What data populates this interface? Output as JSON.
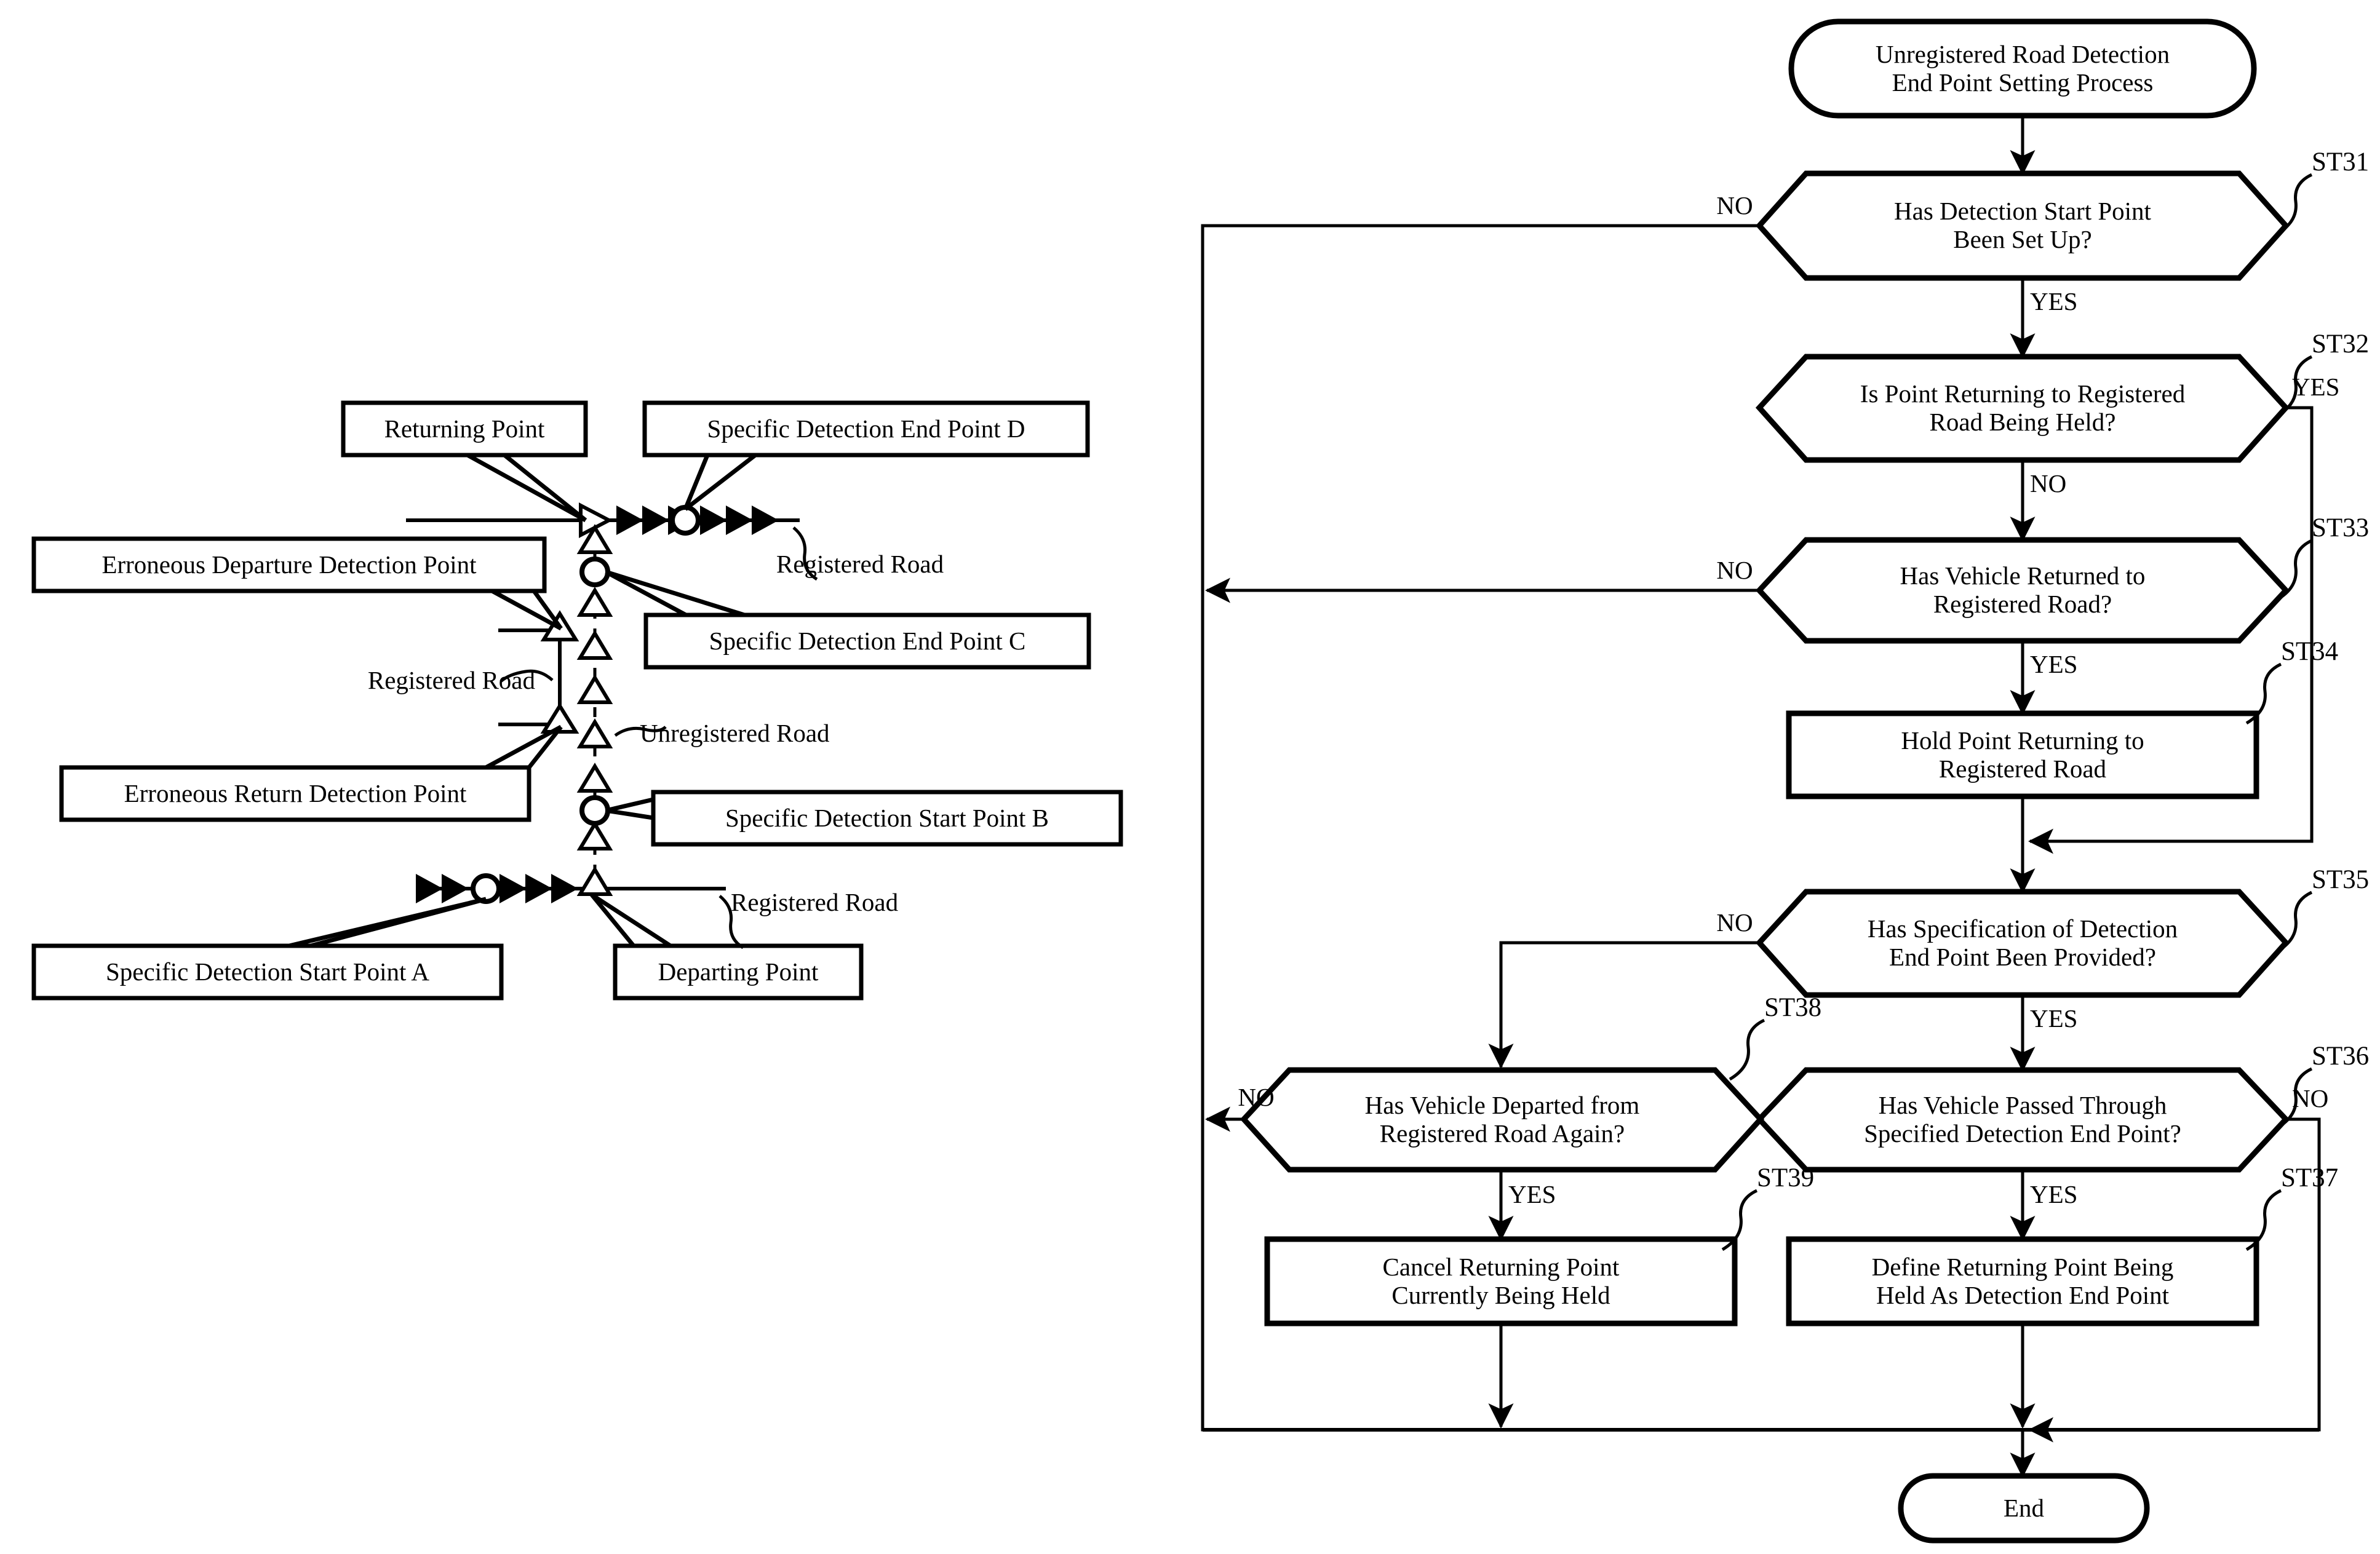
{
  "figure": {
    "title": "Unregistered Road Detection End Point Setting Process",
    "type": "patent-figure-flowchart-and-road-diagram"
  },
  "flowchart": {
    "start": {
      "label": "Unregistered Road Detection\nEnd Point Setting Process",
      "shape": "stadium"
    },
    "end": {
      "label": "End",
      "shape": "stadium"
    },
    "nodes": [
      {
        "id": "ST31",
        "step": "ST31",
        "shape": "decision",
        "label": "Has Detection Start Point\nBeen Set Up?"
      },
      {
        "id": "ST32",
        "step": "ST32",
        "shape": "decision",
        "label": "Is Point Returning to Registered\nRoad Being Held?"
      },
      {
        "id": "ST33",
        "step": "ST33",
        "shape": "decision",
        "label": "Has Vehicle Returned to\nRegistered Road?"
      },
      {
        "id": "ST34",
        "step": "ST34",
        "shape": "process",
        "label": "Hold Point Returning to\nRegistered Road"
      },
      {
        "id": "ST35",
        "step": "ST35",
        "shape": "decision",
        "label": "Has Specification of Detection\nEnd Point Been Provided?"
      },
      {
        "id": "ST36",
        "step": "ST36",
        "shape": "decision",
        "label": "Has Vehicle Passed Through\nSpecified Detection End Point?"
      },
      {
        "id": "ST37",
        "step": "ST37",
        "shape": "process",
        "label": "Define Returning Point Being\nHeld As Detection End Point"
      },
      {
        "id": "ST38",
        "step": "ST38",
        "shape": "decision",
        "label": "Has Vehicle Departed from\nRegistered Road Again?"
      },
      {
        "id": "ST39",
        "step": "ST39",
        "shape": "process",
        "label": "Cancel Returning Point\nCurrently Being Held"
      }
    ],
    "edge_labels": {
      "st31_no": "NO",
      "st31_yes": "YES",
      "st32_no": "NO",
      "st32_yes": "YES",
      "st33_no": "NO",
      "st33_yes": "YES",
      "st35_no": "NO",
      "st35_yes": "YES",
      "st36_no": "NO",
      "st36_yes": "YES",
      "st38_no": "NO",
      "st38_yes": "YES"
    }
  },
  "road_diagram": {
    "callouts": [
      {
        "id": "returning-point",
        "label": "Returning Point"
      },
      {
        "id": "specific-detection-end-point-d",
        "label": "Specific Detection End Point D"
      },
      {
        "id": "erroneous-departure-detection-point",
        "label": "Erroneous Departure Detection Point"
      },
      {
        "id": "specific-detection-end-point-c",
        "label": "Specific Detection End Point C"
      },
      {
        "id": "erroneous-return-detection-point",
        "label": "Erroneous Return Detection Point"
      },
      {
        "id": "specific-detection-start-point-b",
        "label": "Specific Detection Start Point B"
      },
      {
        "id": "specific-detection-start-point-a",
        "label": "Specific Detection Start Point A"
      },
      {
        "id": "departing-point",
        "label": "Departing Point"
      }
    ],
    "plain_labels": [
      {
        "id": "registered-road-top",
        "label": "Registered Road"
      },
      {
        "id": "registered-road-middle",
        "label": "Registered Road"
      },
      {
        "id": "unregistered-road",
        "label": "Unregistered Road"
      },
      {
        "id": "registered-road-bottom",
        "label": "Registered Road"
      }
    ],
    "legend": {
      "filled_triangle": "vehicle travel marker on registered road",
      "hollow_triangle": "vehicle travel marker on unregistered road",
      "circle": "specific detection point marker"
    }
  },
  "colors": {
    "stroke": "#000000",
    "background": "#ffffff"
  }
}
